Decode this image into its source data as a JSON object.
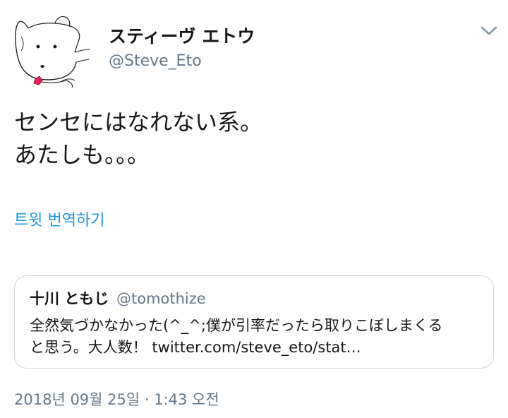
{
  "author": {
    "display_name": "スティーヴ エトウ",
    "handle": "@Steve_Eto",
    "avatar_icon": "dog-sketch-avatar"
  },
  "menu_icon": "chevron-down-icon",
  "tweet": {
    "line1": "センセにはなれない系。",
    "line2": "あたしも。。。"
  },
  "translate_label": "트윗 번역하기",
  "quoted_tweet": {
    "display_name": "十川 ともじ",
    "handle": "@tomothize",
    "line1": "全然気づかなかった(^_^;僕が引率だったら取りこぼしまくる",
    "line2": "と思う。大人数！ twitter.com/steve_eto/stat…"
  },
  "timestamp": "2018년 09월 25일 · 1:43 오전",
  "colors": {
    "link": "#1b95e0",
    "secondary_text": "#657786",
    "border": "#ccd6dd",
    "collar": "#e0245e"
  }
}
